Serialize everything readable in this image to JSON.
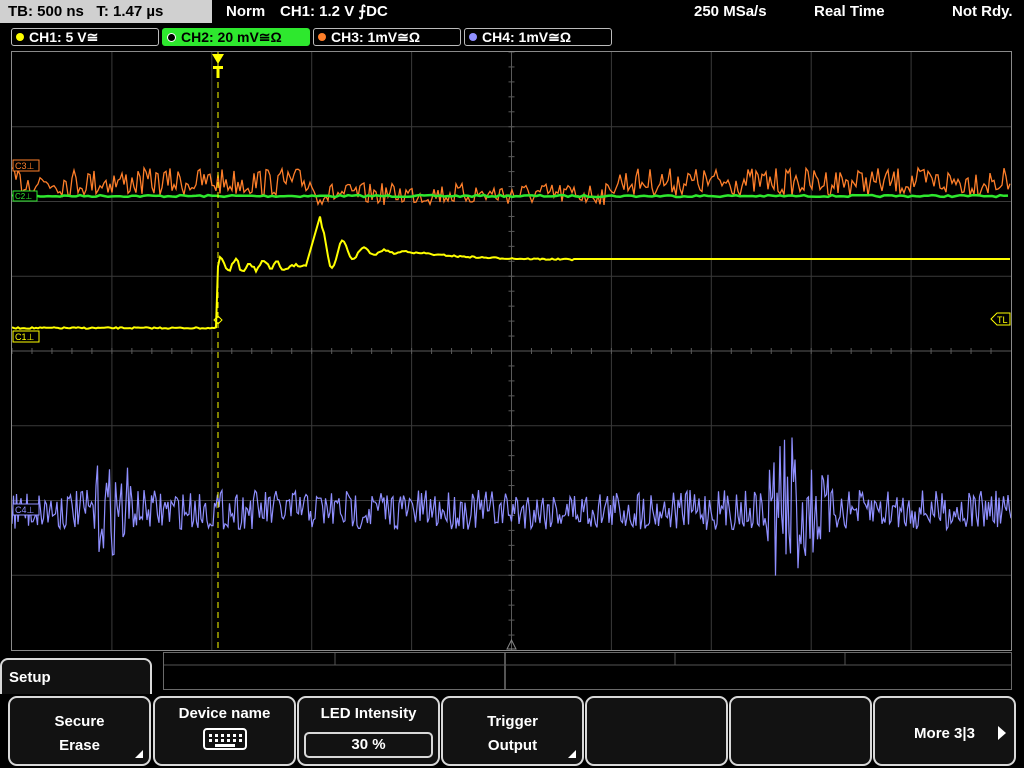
{
  "topbar": {
    "timebase": "TB: 500 ns",
    "trigger_time": "T: 1.47 µs",
    "mode": "Norm",
    "trigger_info": "CH1: 1.2 V ⨍DC",
    "sample_rate": "250 MSa/s",
    "acq_mode": "Real Time",
    "status": "Not Rdy."
  },
  "channels": [
    {
      "label": "CH1: 5 V≅",
      "color": "#ffff00"
    },
    {
      "label": "CH2: 20 mV≅Ω",
      "color": "#2ee82e"
    },
    {
      "label": "CH3: 1mV≅Ω",
      "color": "#ff7f2a"
    },
    {
      "label": "CH4: 1mV≅Ω",
      "color": "#8f8fff"
    }
  ],
  "markers": {
    "c3": "C3⊥",
    "c1": "C1⊥",
    "c4": "C4⊥",
    "c2": "C2⊥",
    "trigger_level": "TL",
    "trigger_pos": "T"
  },
  "menu": {
    "title": "Setup",
    "keys": [
      {
        "line1": "Secure",
        "line2": "Erase"
      },
      {
        "line1": "Device name"
      },
      {
        "line1": "LED Intensity",
        "value": "30 %"
      },
      {
        "line1": "Trigger",
        "line2": "Output"
      },
      {
        "line1": ""
      },
      {
        "line1": ""
      },
      {
        "line1": "More 3|3"
      }
    ]
  },
  "icons": [
    "keyboard-icon",
    "submenu-corner-icon",
    "arrow-right-icon",
    "trigger-marker-icon"
  ]
}
